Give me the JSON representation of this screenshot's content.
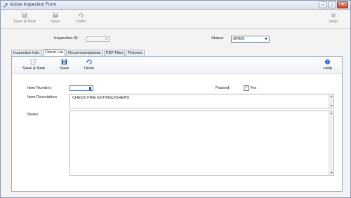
{
  "window": {
    "title": "Active Inspection Form",
    "minimize_glyph": "–",
    "maximize_glyph": "□",
    "close_glyph": "✕"
  },
  "main_toolbar": {
    "save_new": "Save & New",
    "save": "Save",
    "undo": "Undo",
    "help": "Help"
  },
  "form": {
    "inspection_id_label": "Inspection ID",
    "inspection_id_value": "1",
    "status_label": "Status:",
    "status_value": "OPEN"
  },
  "tabs": [
    {
      "label": "Inspection Info."
    },
    {
      "label": "Check List"
    },
    {
      "label": "Recommendations"
    },
    {
      "label": "PDF Files"
    },
    {
      "label": "Pictures"
    }
  ],
  "checklist": {
    "toolbar": {
      "save_new": "Save & New",
      "save": "Save",
      "undo": "Undo",
      "help": "Help"
    },
    "item_number_label": "Item Number:",
    "item_number_value": "",
    "passed_label": "Passed:",
    "passed_checked": true,
    "passed_option": "Yes",
    "item_description_label": "Item Description",
    "item_description_value": "CHECK FIRE EXTINGUISHERS",
    "notes_label": "Notes:",
    "notes_value": ""
  },
  "icons": [
    "app-icon",
    "save-new-icon",
    "save-icon",
    "undo-icon",
    "help-icon"
  ],
  "colors": {
    "accent": "#2a5db0",
    "title_text": "#1d2b3d",
    "close_button": "#c9452c"
  }
}
